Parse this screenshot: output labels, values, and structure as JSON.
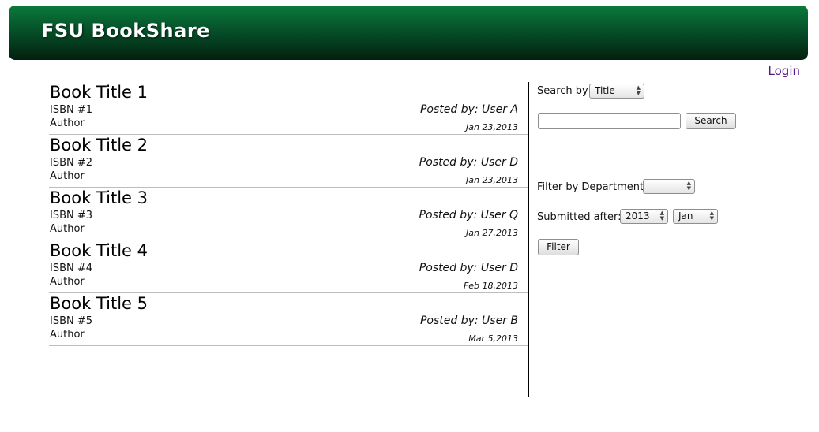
{
  "header": {
    "title": "FSU BookShare",
    "login_label": "Login"
  },
  "books": [
    {
      "title": "Book Title 1",
      "isbn": "ISBN #1",
      "author": "Author",
      "posted": "Posted by: User A",
      "date": "Jan 23,2013"
    },
    {
      "title": "Book Title 2",
      "isbn": "ISBN #2",
      "author": "Author",
      "posted": "Posted by: User D",
      "date": "Jan 23,2013"
    },
    {
      "title": "Book Title 3",
      "isbn": "ISBN #3",
      "author": "Author",
      "posted": "Posted by: User Q",
      "date": "Jan 27,2013"
    },
    {
      "title": "Book Title 4",
      "isbn": "ISBN #4",
      "author": "Author",
      "posted": "Posted by: User D",
      "date": "Feb 18,2013"
    },
    {
      "title": "Book Title 5",
      "isbn": "ISBN #5",
      "author": "Author",
      "posted": "Posted by: User B",
      "date": "Mar 5,2013"
    }
  ],
  "search": {
    "label": "Search by",
    "field_selected": "Title",
    "query_value": "",
    "button_label": "Search"
  },
  "filter": {
    "department_label": "Filter by Department:",
    "department_selected": "",
    "submitted_label": "Submitted after:",
    "year_selected": "2013",
    "month_selected": "Jan",
    "button_label": "Filter"
  },
  "colors": {
    "header_top": "#0a7a3a",
    "header_bottom": "#02200f",
    "link": "#551a8b"
  }
}
